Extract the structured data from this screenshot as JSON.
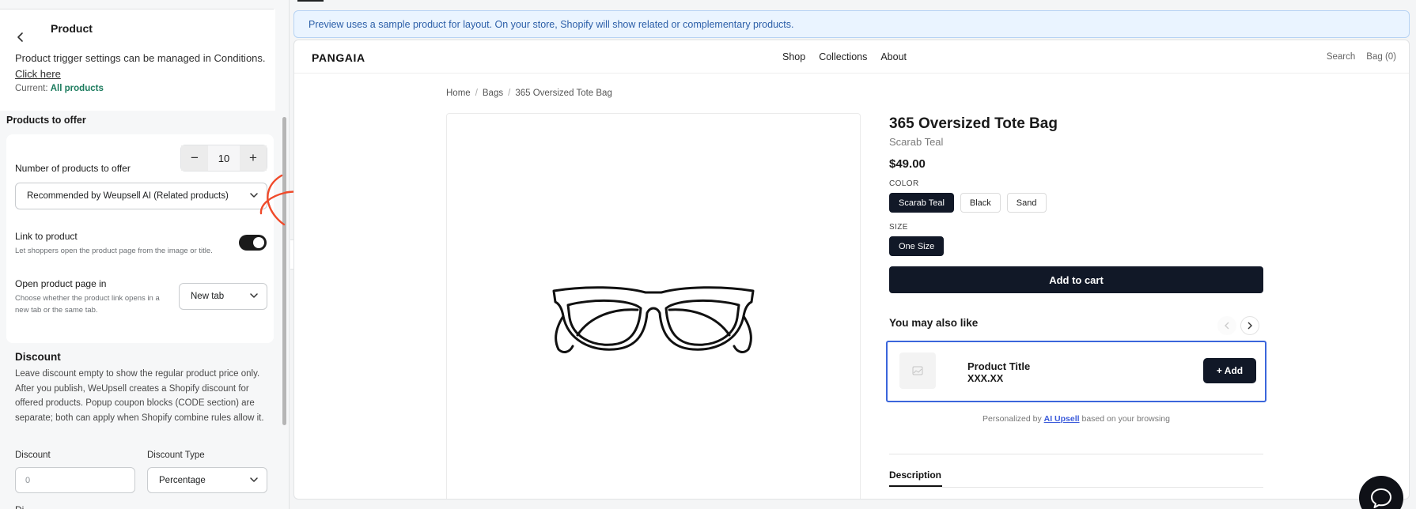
{
  "sidebar": {
    "back_icon": "chevron-left-icon",
    "title": "Product",
    "trigger_text": "Product trigger settings can be managed in Conditions.",
    "trigger_link": "Click here",
    "current_label": "Current:",
    "current_value": "All products",
    "products_section_title": "Products to offer",
    "num_products_label": "Number of products to offer",
    "num_products_value": "10",
    "minus": "−",
    "plus": "+",
    "source_select_value": "Recommended by Weupsell AI (Related products)",
    "link_label": "Link to product",
    "link_help": "Let shoppers open the product page from the image or title.",
    "link_toggle_on": true,
    "open_label": "Open product page in",
    "open_help": "Choose whether the product link opens in a new tab or the same tab.",
    "open_select_value": "New tab",
    "discount_title": "Discount",
    "discount_text": "Leave discount empty to show the regular product price only. After you publish, WeUpsell creates a Shopify discount for offered products. Popup coupon blocks (CODE section) are separate; both can apply when Shopify combine rules allow it.",
    "discount_label": "Discount",
    "discount_placeholder": "0",
    "discount_type_label": "Discount Type",
    "discount_type_value": "Percentage",
    "discount_next_label": "Di"
  },
  "preview": {
    "banner": "Preview uses a sample product for layout. On your store, Shopify will show related or complementary products.",
    "brand": "PANGAIA",
    "nav": [
      "Shop",
      "Collections",
      "About"
    ],
    "nav_right": [
      "Search",
      "Bag (0)"
    ],
    "breadcrumb": [
      "Home",
      "Bags",
      "365 Oversized Tote Bag"
    ],
    "product_title": "365 Oversized Tote Bag",
    "variant": "Scarab Teal",
    "price": "$49.00",
    "color_label": "COLOR",
    "colors": [
      "Scarab Teal",
      "Black",
      "Sand"
    ],
    "size_label": "SIZE",
    "sizes": [
      "One Size"
    ],
    "add_to_cart": "Add to cart",
    "also_like": "You may also like",
    "rec_name": "Product Title",
    "rec_price": "XXX.XX",
    "rec_add": "+ Add",
    "personalized_prefix": "Personalized by",
    "personalized_link": "AI Upsell",
    "personalized_suffix": "based on your browsing",
    "description_tab": "Description"
  },
  "colors": {
    "dark": "#111827",
    "accent_blue": "#3b66db",
    "annotation_red": "#f04a2a",
    "current_green": "#1b7b5d"
  }
}
